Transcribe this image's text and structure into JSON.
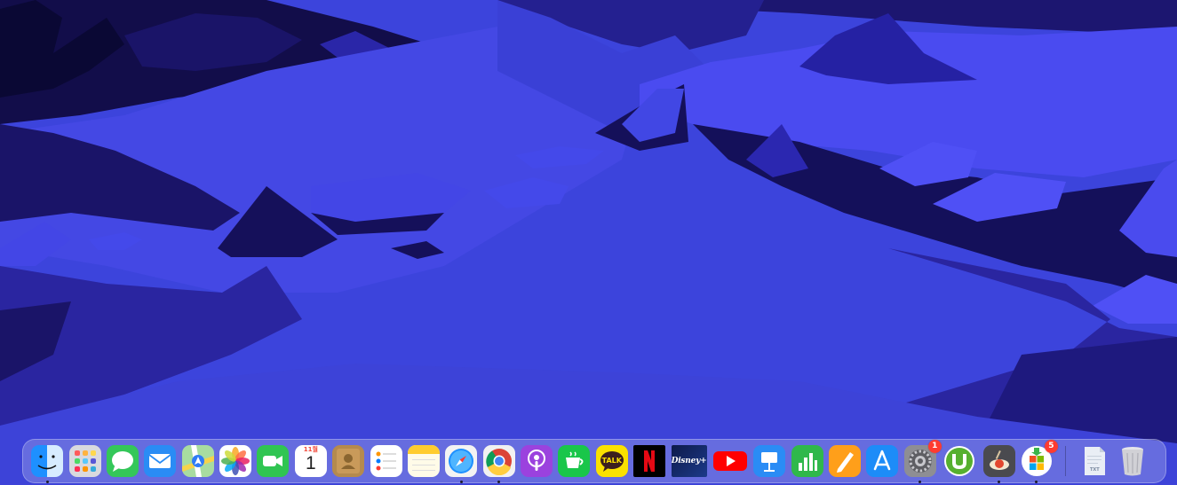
{
  "colors": {
    "sky": "#1f1a7a",
    "water": "#3f49e0",
    "rock_light": "#4a4ae8",
    "rock_dark": "#15105a",
    "badge": "#ff3b30"
  },
  "dock": {
    "apps": [
      {
        "name": "Finder",
        "icon": "finder-icon",
        "running": true
      },
      {
        "name": "Launchpad",
        "icon": "launchpad-icon",
        "running": false
      },
      {
        "name": "Messages",
        "icon": "messages-icon",
        "running": false
      },
      {
        "name": "Mail",
        "icon": "mail-icon",
        "running": false
      },
      {
        "name": "Maps",
        "icon": "maps-icon",
        "running": false
      },
      {
        "name": "Photos",
        "icon": "photos-icon",
        "running": false
      },
      {
        "name": "FaceTime",
        "icon": "facetime-icon",
        "running": false
      },
      {
        "name": "Calendar",
        "icon": "calendar-icon",
        "running": false,
        "month": "11월",
        "day": "1"
      },
      {
        "name": "Contacts",
        "icon": "contacts-icon",
        "running": false
      },
      {
        "name": "Reminders",
        "icon": "reminders-icon",
        "running": false
      },
      {
        "name": "Notes",
        "icon": "notes-icon",
        "running": false
      },
      {
        "name": "Safari",
        "icon": "safari-icon",
        "running": true
      },
      {
        "name": "Google Chrome",
        "icon": "chrome-icon",
        "running": true
      },
      {
        "name": "Podcasts",
        "icon": "podcasts-icon",
        "running": false
      },
      {
        "name": "Naver Cafe",
        "icon": "cafe-cup-icon",
        "running": false
      },
      {
        "name": "KakaoTalk",
        "icon": "kakaotalk-icon",
        "running": false,
        "label": "TALK"
      },
      {
        "name": "Netflix",
        "icon": "netflix-icon",
        "running": false
      },
      {
        "name": "Disney+",
        "icon": "disney-plus-icon",
        "running": false,
        "label": "Disney+"
      },
      {
        "name": "YouTube",
        "icon": "youtube-icon",
        "running": false
      },
      {
        "name": "Keynote",
        "icon": "keynote-icon",
        "running": false
      },
      {
        "name": "Numbers",
        "icon": "numbers-icon",
        "running": false
      },
      {
        "name": "Pages",
        "icon": "pages-icon",
        "running": false
      },
      {
        "name": "App Store",
        "icon": "app-store-icon",
        "running": false
      },
      {
        "name": "System Preferences",
        "icon": "gear-icon",
        "running": true,
        "badge": "1"
      },
      {
        "name": "uTorrent",
        "icon": "utorrent-icon",
        "running": false
      },
      {
        "name": "Recording app",
        "icon": "recorder-icon",
        "running": true
      },
      {
        "name": "Microsoft AutoUpdate",
        "icon": "microsoft-update-icon",
        "running": true,
        "badge": "5"
      }
    ],
    "stacks": [
      {
        "name": "TXT document",
        "icon": "txt-file-icon",
        "label": "TXT"
      },
      {
        "name": "Trash",
        "icon": "trash-icon"
      }
    ]
  }
}
